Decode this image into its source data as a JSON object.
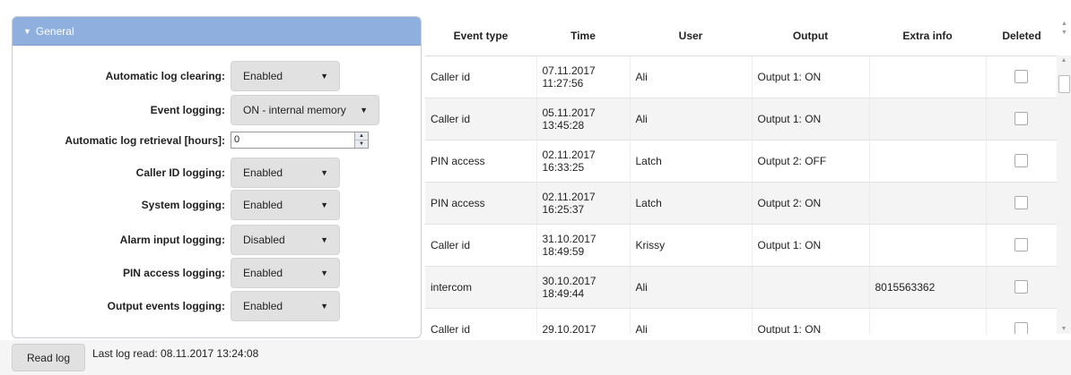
{
  "general": {
    "header": "General",
    "rows": [
      {
        "label": "Automatic log clearing:",
        "value": "Enabled"
      },
      {
        "label": "Event logging:",
        "value": "ON - internal memory"
      },
      {
        "label": "Automatic log retrieval [hours]:",
        "value": "0"
      },
      {
        "label": "Caller ID logging:",
        "value": "Enabled"
      },
      {
        "label": "System logging:",
        "value": "Enabled"
      },
      {
        "label": "Alarm input logging:",
        "value": "Disabled"
      },
      {
        "label": "PIN access logging:",
        "value": "Enabled"
      },
      {
        "label": "Output events logging:",
        "value": "Enabled"
      }
    ]
  },
  "table": {
    "headers": [
      "Event type",
      "Time",
      "User",
      "Output",
      "Extra info",
      "Deleted"
    ],
    "rows": [
      {
        "event": "Caller id",
        "date": "07.11.2017",
        "time": "11:27:56",
        "user": "Ali",
        "output": "Output 1: ON",
        "extra": ""
      },
      {
        "event": "Caller id",
        "date": "05.11.2017",
        "time": "13:45:28",
        "user": "Ali",
        "output": "Output 1: ON",
        "extra": ""
      },
      {
        "event": "PIN access",
        "date": "02.11.2017",
        "time": "16:33:25",
        "user": "Latch",
        "output": "Output 2: OFF",
        "extra": ""
      },
      {
        "event": "PIN access",
        "date": "02.11.2017",
        "time": "16:25:37",
        "user": "Latch",
        "output": "Output 2: ON",
        "extra": ""
      },
      {
        "event": "Caller id",
        "date": "31.10.2017",
        "time": "18:49:59",
        "user": "Krissy",
        "output": "Output 1: ON",
        "extra": ""
      },
      {
        "event": "intercom",
        "date": "30.10.2017",
        "time": "18:49:44",
        "user": "Ali",
        "output": "",
        "extra": "8015563362"
      },
      {
        "event": "Caller id",
        "date": "29.10.2017",
        "time": "",
        "user": "Ali",
        "output": "Output 1: ON",
        "extra": ""
      }
    ]
  },
  "footer": {
    "read_button": "Read log",
    "last_read": "Last log read: 08.11.2017 13:24:08"
  }
}
